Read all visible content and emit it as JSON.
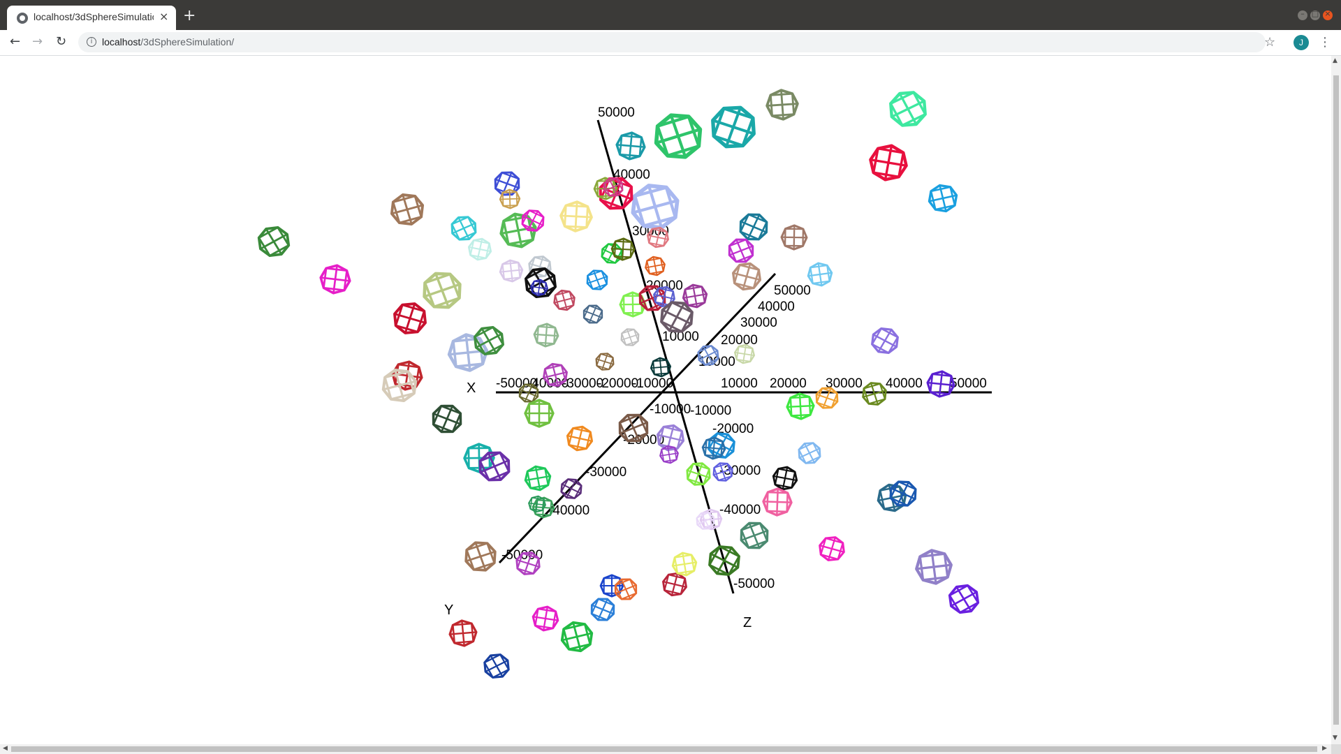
{
  "browser": {
    "tab_title": "localhost/3dSphereSimulation/",
    "tab_close_glyph": "×",
    "new_tab_glyph": "+",
    "url_host": "localhost",
    "url_path": "/3dSphereSimulation/",
    "avatar_letter": "J",
    "icons": {
      "back": "back-arrow-icon",
      "forward": "forward-arrow-icon",
      "reload": "reload-icon",
      "info": "info-icon",
      "star": "star-icon",
      "menu": "kebab-menu-icon"
    }
  },
  "scene": {
    "axes": {
      "x": {
        "name": "X",
        "ticks": [
          "-50000",
          "-40000",
          "-30000",
          "-20000",
          "-10000",
          "10000",
          "20000",
          "30000",
          "40000",
          "50000"
        ]
      },
      "y": {
        "name": "Y",
        "ticks": [
          "50000",
          "40000",
          "30000",
          "20000",
          "10000",
          "-10000",
          "-20000",
          "-30000",
          "-40000",
          "-50000"
        ]
      },
      "z": {
        "name": "Z",
        "ticks": [
          "50000",
          "40000",
          "30000",
          "20000",
          "10000",
          "-10000",
          "-20000",
          "-30000",
          "-40000",
          "-50000"
        ]
      }
    },
    "spheres": [
      {
        "color": "#3a8a3a"
      },
      {
        "color": "#e61ec8"
      },
      {
        "color": "#a0785a"
      },
      {
        "color": "#3e4ed6"
      },
      {
        "color": "#caa050"
      },
      {
        "color": "#36c9d4"
      },
      {
        "color": "#bfeee6"
      },
      {
        "color": "#55bb55"
      },
      {
        "color": "#e61ec8"
      },
      {
        "color": "#f4e38a"
      },
      {
        "color": "#b6c882"
      },
      {
        "color": "#c8102e"
      },
      {
        "color": "#a8b8e0"
      },
      {
        "color": "#3f8f3f"
      },
      {
        "color": "#c0282e"
      },
      {
        "color": "#d6cbb8"
      },
      {
        "color": "#2f4f35"
      },
      {
        "color": "#17b0aa"
      },
      {
        "color": "#6a2fa8"
      },
      {
        "color": "#f08a20"
      },
      {
        "color": "#1ec85a"
      },
      {
        "color": "#5a2e7a"
      },
      {
        "color": "#3aa05a"
      },
      {
        "color": "#a0785a"
      },
      {
        "color": "#b040c0"
      },
      {
        "color": "#c0282e"
      },
      {
        "color": "#1840a0"
      },
      {
        "color": "#e61ec8"
      },
      {
        "color": "#22bb44"
      },
      {
        "color": "#2b7fd8"
      },
      {
        "color": "#1a44cc"
      },
      {
        "color": "#e86a30"
      },
      {
        "color": "#b8243a"
      },
      {
        "color": "#e6ee66"
      },
      {
        "color": "#3a7a24"
      },
      {
        "color": "#1a9aa8"
      },
      {
        "color": "#2ec46a"
      },
      {
        "color": "#1aa8a8"
      },
      {
        "color": "#7a8a64"
      },
      {
        "color": "#3ee8a0"
      },
      {
        "color": "#e8103e"
      },
      {
        "color": "#1aa0e0"
      },
      {
        "color": "#1a7a98"
      },
      {
        "color": "#a07868"
      },
      {
        "color": "#c030d0"
      },
      {
        "color": "#b8917a"
      },
      {
        "color": "#70c8f0"
      },
      {
        "color": "#8a70e0"
      },
      {
        "color": "#5a20d0"
      },
      {
        "color": "#6a8a20"
      },
      {
        "color": "#f0a030"
      },
      {
        "color": "#3ee840"
      },
      {
        "color": "#80b8f0"
      },
      {
        "color": "#111111"
      },
      {
        "color": "#2a6a8a"
      },
      {
        "color": "#1a58b0"
      },
      {
        "color": "#f060a0"
      },
      {
        "color": "#4a8a70"
      },
      {
        "color": "#f020c0"
      },
      {
        "color": "#9080c8"
      },
      {
        "color": "#6a20e0"
      },
      {
        "color": "#2a9a5a"
      },
      {
        "color": "#a8b8f0"
      },
      {
        "color": "#e8104a"
      },
      {
        "color": "#8aa83a"
      },
      {
        "color": "#d03a8a"
      },
      {
        "color": "#e07880"
      },
      {
        "color": "#e06020"
      },
      {
        "color": "#20c840"
      },
      {
        "color": "#5a6a10"
      },
      {
        "color": "#1a90e0"
      },
      {
        "color": "#c0c8d0"
      },
      {
        "color": "#d8c8e8"
      },
      {
        "color": "#111111"
      },
      {
        "color": "#2a2ab0"
      },
      {
        "color": "#c04860"
      },
      {
        "color": "#4a6a8a"
      },
      {
        "color": "#80f050"
      },
      {
        "color": "#b8203a"
      },
      {
        "color": "#5a60d0"
      },
      {
        "color": "#9a3a9a"
      },
      {
        "color": "#6a5a68"
      },
      {
        "color": "#90b890"
      },
      {
        "color": "#c0c0c0"
      },
      {
        "color": "#8a6a40"
      },
      {
        "color": "#0a3a3a"
      },
      {
        "color": "#6a8ad0"
      },
      {
        "color": "#c8d8a8"
      },
      {
        "color": "#b040b8"
      },
      {
        "color": "#6a6a30"
      },
      {
        "color": "#70c040"
      },
      {
        "color": "#7a5a48"
      },
      {
        "color": "#9a80d8"
      },
      {
        "color": "#9a40c8"
      },
      {
        "color": "#1a90d8"
      },
      {
        "color": "#2a70a8"
      },
      {
        "color": "#6060e0"
      },
      {
        "color": "#80e840"
      },
      {
        "color": "#e0c8f0"
      },
      {
        "color": "#e8d8f8"
      }
    ]
  }
}
